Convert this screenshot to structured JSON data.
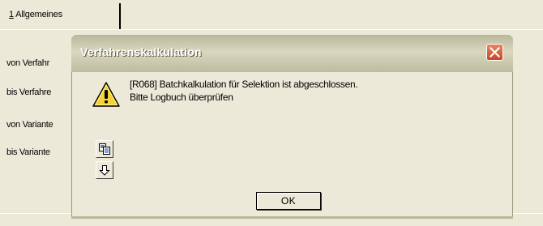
{
  "tab": {
    "mnemonic": "1",
    "label": " Allgemeines"
  },
  "form": {
    "labels": [
      "von Verfahr",
      "bis Verfahre",
      "von Variante",
      "bis Variante"
    ]
  },
  "dialog": {
    "title": "Verfahrenskalkulation",
    "message_line1": "[R068] Batchkalkulation für Selektion ist abgeschlossen.",
    "message_line2": "Bitte Logbuch überprüfen",
    "ok_label": "OK",
    "icons": {
      "message": "warning-icon",
      "copy": "copy-icon",
      "save": "arrow-down-icon",
      "close": "close-icon"
    }
  },
  "colors": {
    "background": "#ECE9D8",
    "close_button": "#d05a34",
    "title_text": "#ffffff"
  }
}
